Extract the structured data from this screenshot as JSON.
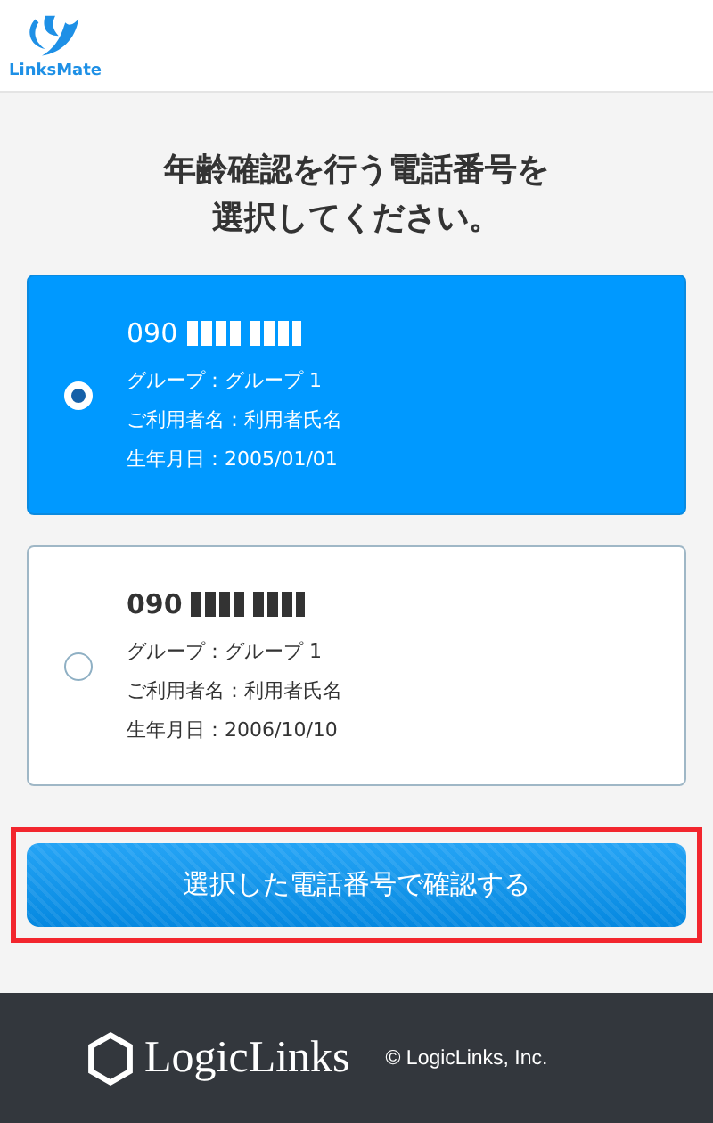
{
  "header": {
    "logo_text": "LinksMate"
  },
  "title": [
    "年齢確認を行う電話番号を",
    "選択してください。"
  ],
  "numbers": [
    {
      "prefix": "090",
      "selected": true,
      "group": "グループ：グループ 1",
      "user": "ご利用者名：利用者氏名",
      "birthday": "生年月日：2005/01/01"
    },
    {
      "prefix": "090",
      "selected": false,
      "group": "グループ：グループ 1",
      "user": "ご利用者名：利用者氏名",
      "birthday": "生年月日：2006/10/10"
    }
  ],
  "confirm_button": {
    "label": "選択した電話番号で確認する",
    "highlighted": true
  },
  "footer": {
    "logo_text": "LogicLinks",
    "copyright": "© LogicLinks, Inc."
  }
}
